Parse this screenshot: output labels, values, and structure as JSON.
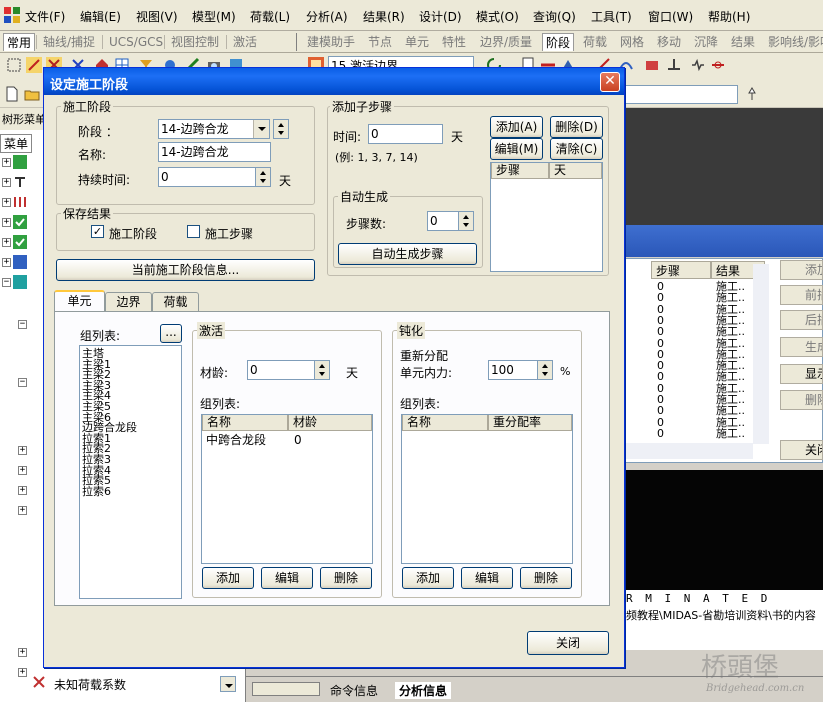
{
  "menubar": {
    "items": [
      "文件(F)",
      "编辑(E)",
      "视图(V)",
      "模型(M)",
      "荷载(L)",
      "分析(A)",
      "结果(R)",
      "设计(D)",
      "模式(O)",
      "查询(Q)",
      "工具(T)",
      "窗口(W)",
      "帮助(H)"
    ]
  },
  "tabbar": {
    "left_tabs": [
      "常用",
      "轴线/捕捉",
      "UCS/GCS",
      "视图控制",
      "激活"
    ],
    "right_tabs": [
      "建模助手",
      "节点",
      "单元",
      "特性",
      "边界/质量",
      "阶段",
      "荷载",
      "网格",
      "移动",
      "沉降",
      "结果",
      "影响线/影响"
    ],
    "active_right": "阶段"
  },
  "toolbar": {
    "stage_combo": "15 激活边界"
  },
  "left_panel": {
    "header": "树形菜单",
    "menu_tab": "菜单",
    "bottom_item": "未知荷载系数"
  },
  "background": {
    "table_headers": [
      "步骤",
      "结果"
    ],
    "table_rows": [
      [
        "0",
        "施工.."
      ],
      [
        "0",
        "施工.."
      ],
      [
        "0",
        "施工.."
      ],
      [
        "0",
        "施工.."
      ],
      [
        "0",
        "施工.."
      ],
      [
        "0",
        "施工.."
      ],
      [
        "0",
        "施工.."
      ],
      [
        "0",
        "施工.."
      ],
      [
        "0",
        "施工.."
      ],
      [
        "0",
        "施工.."
      ],
      [
        "0",
        "施工.."
      ],
      [
        "0",
        "施工.."
      ],
      [
        "0",
        "施工.."
      ],
      [
        "0",
        "施工.."
      ]
    ],
    "side_buttons": [
      "添加",
      "前插",
      "后插",
      "生成",
      "显示",
      "删除",
      "关闭"
    ],
    "log_line1": "R M I N A T E D",
    "log_line2": "频教程\\MIDAS-省勘培训资料\\书的内容",
    "bottom_tabs": [
      "命令信息",
      "分析信息"
    ],
    "watermark": "桥頭堡",
    "watermark_url": "Bridgehead.com.cn"
  },
  "dialog": {
    "title": "设定施工阶段",
    "stage_group": {
      "title": "施工阶段",
      "stage_label": "阶段 ：",
      "stage_value": "14-边跨合龙",
      "name_label": "名称:",
      "name_value": "14-边跨合龙",
      "duration_label": "持续时间:",
      "duration_value": "0",
      "duration_unit": "天"
    },
    "save_group": {
      "title": "保存结果",
      "opt1": "施工阶段",
      "opt1_checked": "✓",
      "opt2": "施工步骤"
    },
    "info_button": "当前施工阶段信息...",
    "substep_group": {
      "title": "添加子步骤",
      "time_label": "时间:",
      "time_value": "0",
      "time_unit": "天",
      "example": "(例: 1, 3, 7, 14)",
      "add_button": "添加(A)",
      "delete_button": "删除(D)",
      "edit_button": "编辑(M)",
      "clear_button": "清除(C)",
      "col_step": "步骤",
      "col_day": "天",
      "auto_title": "自动生成",
      "step_count_label": "步骤数:",
      "step_count_value": "0",
      "auto_button": "自动生成步骤"
    },
    "tabs": [
      "单元",
      "边界",
      "荷载"
    ],
    "active_tab": "单元",
    "group_list": {
      "label": "组列表:",
      "browse": "...",
      "items": [
        "主塔",
        "主梁1",
        "主梁2",
        "主梁3",
        "主梁4",
        "主梁5",
        "主梁6",
        "边跨合龙段",
        "拉索1",
        "拉索2",
        "拉索3",
        "拉索4",
        "拉索5",
        "拉索6"
      ]
    },
    "activate": {
      "title": "激活",
      "age_label": "材龄:",
      "age_value": "0",
      "age_unit": "天",
      "list_label": "组列表:",
      "col_name": "名称",
      "col_age": "材龄",
      "rows": [
        {
          "name": "中跨合龙段",
          "age": "0"
        }
      ],
      "add": "添加",
      "edit": "编辑",
      "delete": "删除"
    },
    "passivate": {
      "title": "钝化",
      "redistribute": "重新分配",
      "force_label": "单元内力:",
      "force_value": "100",
      "force_unit": "%",
      "list_label": "组列表:",
      "col_name": "名称",
      "col_ratio": "重分配率",
      "add": "添加",
      "edit": "编辑",
      "delete": "删除"
    },
    "close_button": "关闭"
  }
}
